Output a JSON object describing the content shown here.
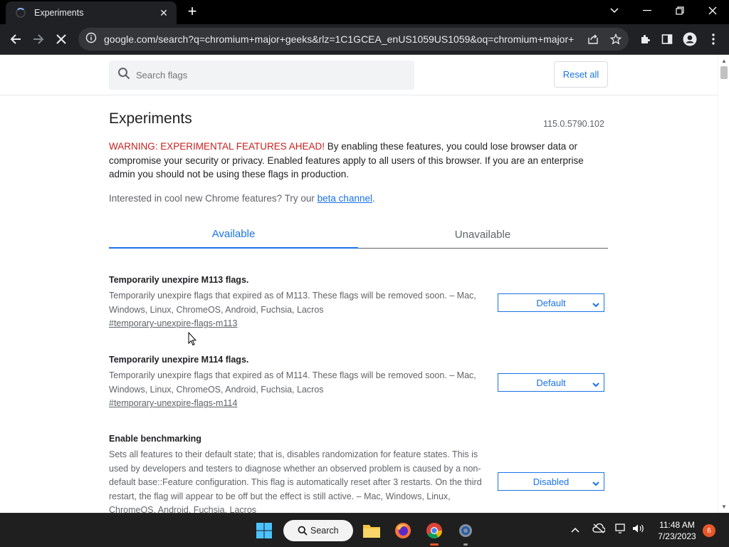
{
  "browser": {
    "tab_title": "Experiments",
    "address": "google.com/search?q=chromium+major+geeks&rlz=1C1GCEA_enUS1059US1059&oq=chromium+major+..."
  },
  "header": {
    "search_placeholder": "Search flags",
    "reset_label": "Reset all"
  },
  "main": {
    "title": "Experiments",
    "version": "115.0.5790.102",
    "warning_red": "WARNING: EXPERIMENTAL FEATURES AHEAD!",
    "warning_text": " By enabling these features, you could lose browser data or compromise your security or privacy. Enabled features apply to all users of this browser. If you are an enterprise admin you should not be using these flags in production.",
    "interested_text": "Interested in cool new Chrome features? Try our ",
    "beta_link": "beta channel",
    "interested_end": ".",
    "tabs": [
      {
        "label": "Available"
      },
      {
        "label": "Unavailable"
      }
    ],
    "flags": [
      {
        "name": "Temporarily unexpire M113 flags.",
        "description": "Temporarily unexpire flags that expired as of M113. These flags will be removed soon. – Mac, Windows, Linux, ChromeOS, Android, Fuchsia, Lacros",
        "link": "#temporary-unexpire-flags-m113",
        "value": "Default"
      },
      {
        "name": "Temporarily unexpire M114 flags.",
        "description": "Temporarily unexpire flags that expired as of M114. These flags will be removed soon. – Mac, Windows, Linux, ChromeOS, Android, Fuchsia, Lacros",
        "link": "#temporary-unexpire-flags-m114",
        "value": "Default"
      },
      {
        "name": "Enable benchmarking",
        "description": "Sets all features to their default state; that is, disables randomization for feature states. This is used by developers and testers to diagnose whether an observed problem is caused by a non-default base::Feature configuration. This flag is automatically reset after 3 restarts. On the third restart, the flag will appear to be off but the effect is still active. – Mac, Windows, Linux, ChromeOS, Android, Fuchsia, Lacros",
        "value": "Disabled"
      }
    ]
  },
  "taskbar": {
    "search_label": "Search",
    "time": "11:48 AM",
    "date": "7/23/2023",
    "notification_count": "6"
  }
}
